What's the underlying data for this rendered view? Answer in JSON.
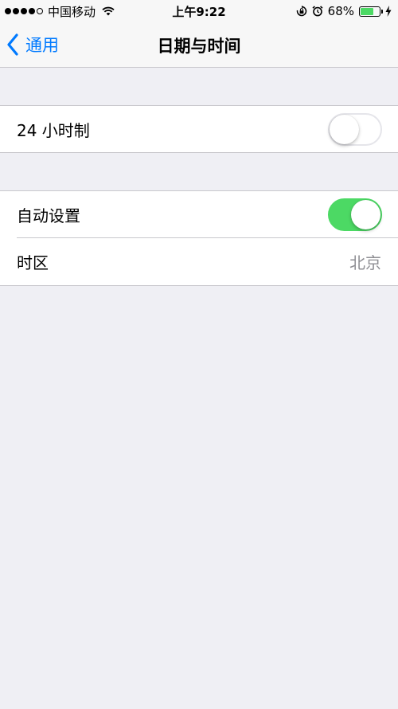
{
  "status_bar": {
    "carrier": "中国移动",
    "signal_bars_filled": 4,
    "signal_bars_total": 5,
    "time": "上午9:22",
    "battery_percent": "68%",
    "battery_level": 0.68,
    "icons": [
      "wifi-icon",
      "rotation-lock-icon",
      "alarm-icon",
      "battery-icon",
      "charging-icon"
    ]
  },
  "nav": {
    "back_label": "通用",
    "title": "日期与时间"
  },
  "settings": {
    "hour24": {
      "label": "24 小时制",
      "enabled": false
    },
    "auto_set": {
      "label": "自动设置",
      "enabled": true
    },
    "time_zone": {
      "label": "时区",
      "value": "北京"
    }
  },
  "colors": {
    "accent": "#007aff",
    "toggle_on": "#4cd964",
    "background": "#efeff4",
    "secondary_text": "#8e8e93"
  }
}
